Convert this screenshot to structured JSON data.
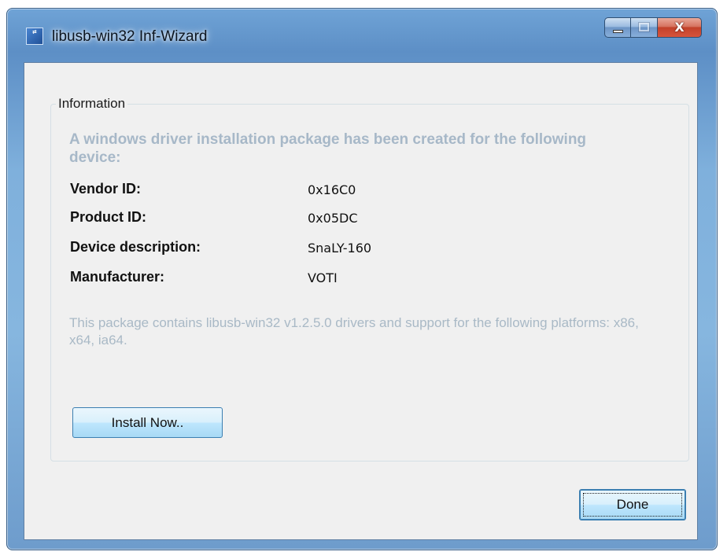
{
  "window": {
    "title": "libusb-win32 Inf-Wizard",
    "icon": "usb-app-icon",
    "caption_buttons": {
      "minimize_icon": "minimize-icon",
      "maximize_icon": "maximize-icon",
      "close_glyph": "X"
    }
  },
  "group": {
    "title": "Information",
    "heading": "A windows driver installation package has been created for the following device:",
    "fields": [
      {
        "label": "Vendor ID:",
        "value": "0x16C0"
      },
      {
        "label": "Product ID:",
        "value": "0x05DC"
      },
      {
        "label": "Device description:",
        "value": "SnaLY-160"
      },
      {
        "label": "Manufacturer:",
        "value": "VOTI"
      }
    ],
    "note": "This package contains libusb-win32 v1.2.5.0 drivers and support for the following platforms: x86, x64, ia64.",
    "install_button": "Install Now.."
  },
  "footer": {
    "done_button": "Done"
  },
  "colors": {
    "heading": "#a7b8c8",
    "note": "#a9b9c6",
    "frame": "#6fa3d6",
    "close": "#c2412a",
    "client": "#f0f0f0"
  }
}
